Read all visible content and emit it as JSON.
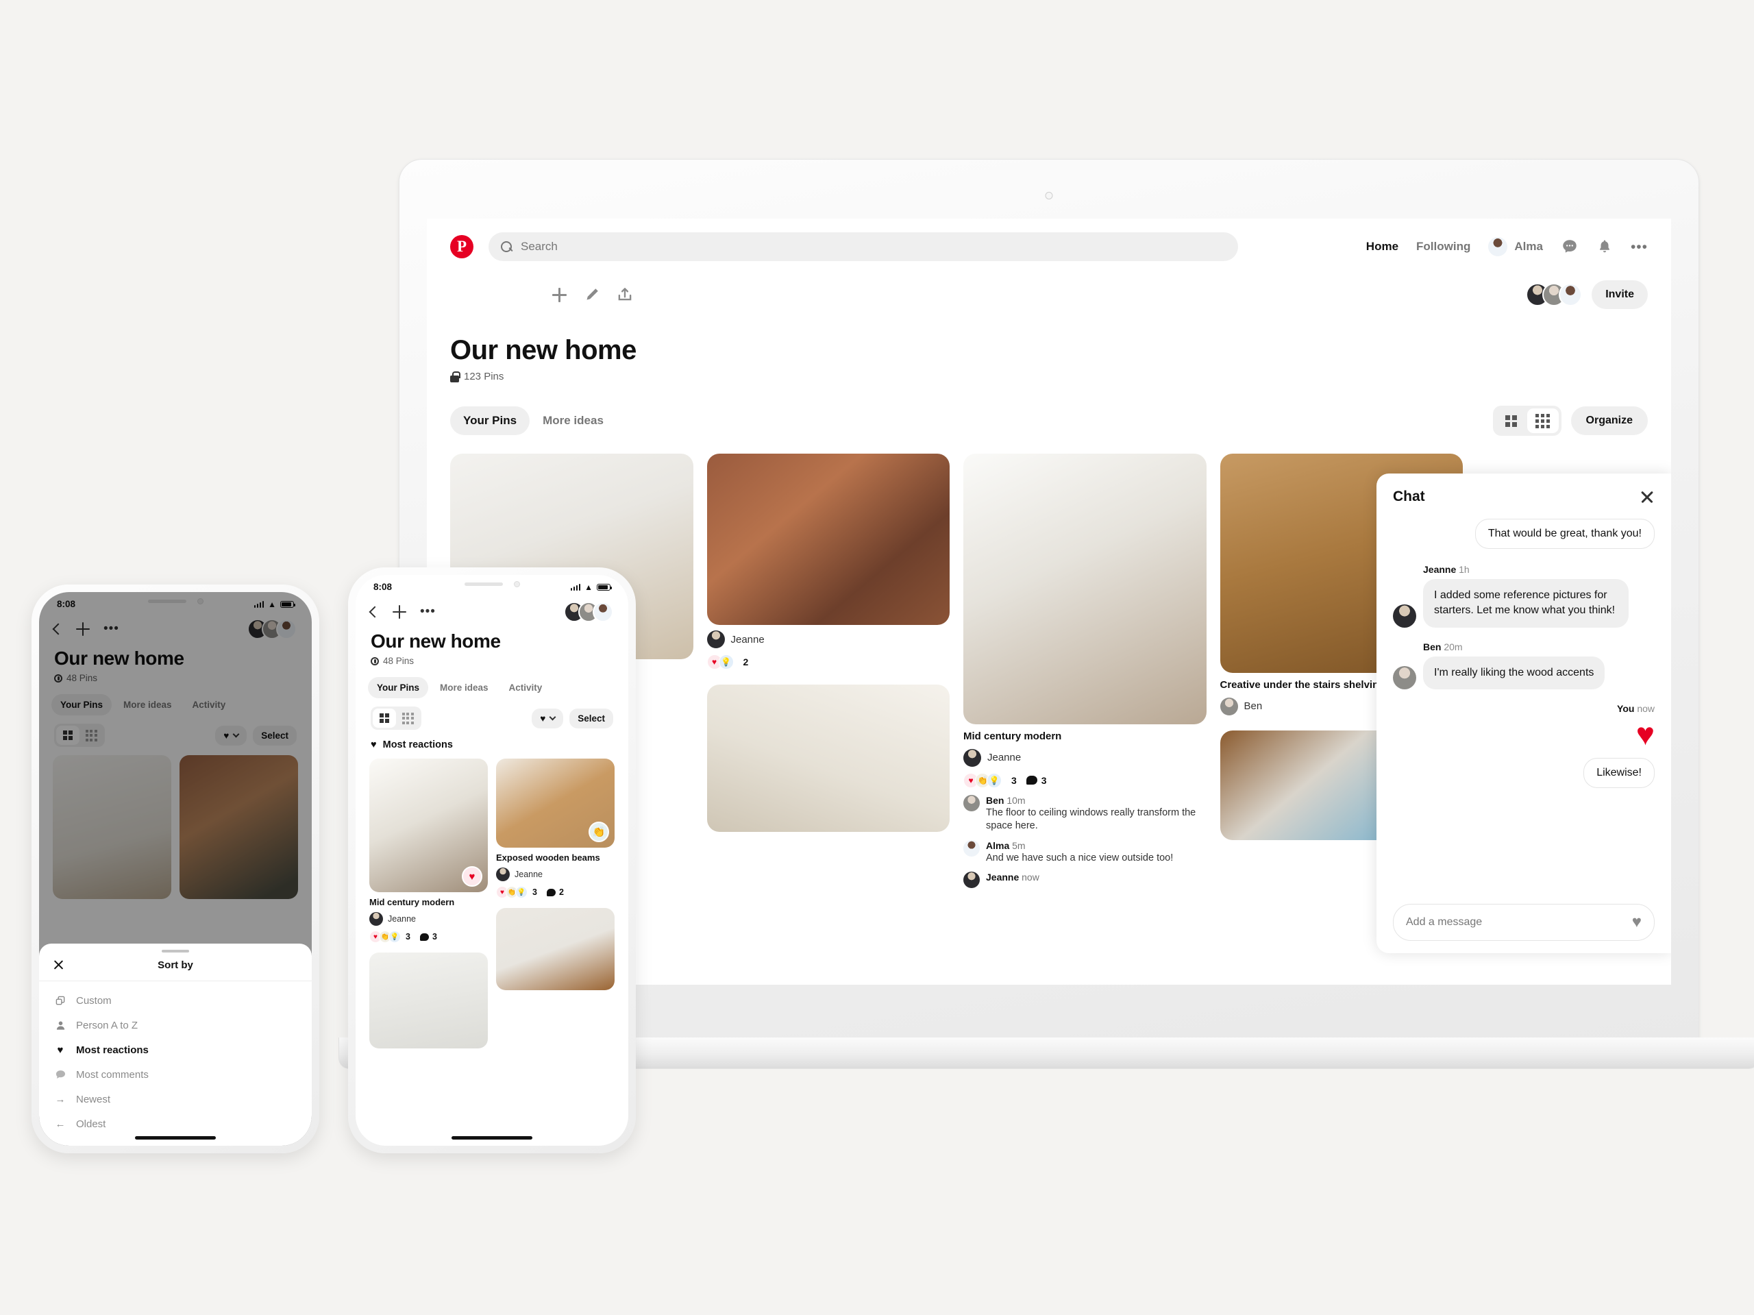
{
  "desktop": {
    "brand": "Pinterest",
    "search": {
      "placeholder": "Search",
      "icon": "search-icon"
    },
    "nav": {
      "home": "Home",
      "following": "Following",
      "account": "Alma",
      "messages_icon": "chat-bubble-icon",
      "notifications_icon": "bell-icon",
      "more_icon": "ellipsis-icon"
    },
    "toolbar": {
      "add_icon": "plus-icon",
      "edit_icon": "pencil-icon",
      "share_icon": "upload-icon",
      "invite_label": "Invite"
    },
    "board": {
      "title": "Our new home",
      "privacy_icon": "lock-icon",
      "pin_count": "123 Pins",
      "tabs": [
        {
          "label": "Your Pins",
          "active": true
        },
        {
          "label": "More ideas",
          "active": false
        }
      ],
      "view_grid_4_icon": "grid-large-icon",
      "view_grid_9_icon": "grid-small-icon",
      "organize_label": "Organize"
    },
    "pins": [
      {
        "title": "",
        "user": "",
        "image": "bright-white-living-room"
      },
      {
        "title": "",
        "user": "Jeanne",
        "image": "loft-window-chair",
        "reactions": "2",
        "reaction_icons": [
          "heart",
          "bulb"
        ]
      },
      {
        "title": "Mid century modern",
        "user": "Jeanne",
        "image": "mid-century-living-room",
        "reactions": "3",
        "comments": "3",
        "reaction_icons": [
          "heart",
          "clap",
          "bulb"
        ],
        "thread": [
          {
            "author": "Ben",
            "time": "10m",
            "text": "The floor to ceiling windows really transform the space here."
          },
          {
            "author": "Alma",
            "time": "5m",
            "text": "And we have such a nice view outside too!"
          },
          {
            "author": "Jeanne",
            "time": "now",
            "text": ""
          }
        ]
      },
      {
        "title": "Creative under the stairs shelving",
        "user": "Ben",
        "image": "wooden-shelving-stairs"
      }
    ],
    "chat": {
      "title": "Chat",
      "close_icon": "close-icon",
      "messages": [
        {
          "side": "out",
          "author": "",
          "time": "",
          "text": "That would be great, thank you!"
        },
        {
          "side": "in",
          "author": "Jeanne",
          "time": "1h",
          "text": "I added some reference pictures for starters. Let me know what you think!"
        },
        {
          "side": "in",
          "author": "Ben",
          "time": "20m",
          "text": "I'm really liking the wood accents"
        },
        {
          "side": "out",
          "author": "You",
          "time": "now",
          "text": "",
          "reaction": "heart"
        },
        {
          "side": "out",
          "author": "",
          "time": "",
          "text": "Likewise!"
        }
      ],
      "input_placeholder": "Add a message",
      "heart_icon": "heart-icon"
    }
  },
  "phone_left": {
    "status": {
      "time": "8:08",
      "signal_icon": "cellular-icon",
      "wifi_icon": "wifi-icon",
      "battery_icon": "battery-icon"
    },
    "nav": {
      "back_icon": "chevron-left-icon",
      "add_icon": "plus-icon",
      "more_icon": "ellipsis-icon"
    },
    "board": {
      "title": "Our new home",
      "privacy_icon": "lock-icon",
      "pin_count": "48 Pins",
      "tabs": [
        {
          "label": "Your Pins",
          "active": true
        },
        {
          "label": "More ideas",
          "active": false
        },
        {
          "label": "Activity",
          "active": false
        }
      ],
      "select_label": "Select",
      "sort_icon": "heart-icon"
    },
    "sheet": {
      "title": "Sort by",
      "close_icon": "close-icon",
      "options": [
        {
          "label": "Custom",
          "icon": "cards-icon",
          "selected": false
        },
        {
          "label": "Person A to Z",
          "icon": "person-icon",
          "selected": false
        },
        {
          "label": "Most reactions",
          "icon": "heart-icon",
          "selected": true
        },
        {
          "label": "Most comments",
          "icon": "chat-bubble-icon",
          "selected": false
        },
        {
          "label": "Newest",
          "icon": "arrow-right-icon",
          "selected": false
        },
        {
          "label": "Oldest",
          "icon": "arrow-left-icon",
          "selected": false
        }
      ]
    }
  },
  "phone_right": {
    "status": {
      "time": "8:08",
      "signal_icon": "cellular-icon",
      "wifi_icon": "wifi-icon",
      "battery_icon": "battery-icon"
    },
    "nav": {
      "back_icon": "chevron-left-icon",
      "add_icon": "plus-icon",
      "more_icon": "ellipsis-icon"
    },
    "board": {
      "title": "Our new home",
      "privacy_icon": "lock-icon",
      "pin_count": "48 Pins",
      "tabs": [
        {
          "label": "Your Pins",
          "active": true
        },
        {
          "label": "More ideas",
          "active": false
        },
        {
          "label": "Activity",
          "active": false
        }
      ],
      "select_label": "Select",
      "sort_label": "Most reactions",
      "sort_icon": "heart-icon"
    },
    "pins": [
      {
        "title": "Mid century modern",
        "user": "Jeanne",
        "reactions": "3",
        "comments": "3",
        "badge": "heart",
        "image": "mid-century-living-room"
      },
      {
        "title": "Exposed wooden beams",
        "user": "Jeanne",
        "reactions": "3",
        "comments": "2",
        "badge": "clap",
        "image": "exposed-wooden-beams"
      },
      {
        "title": "",
        "user": "",
        "image": "white-room"
      },
      {
        "title": "",
        "user": "",
        "image": "wood-ceiling"
      }
    ]
  }
}
